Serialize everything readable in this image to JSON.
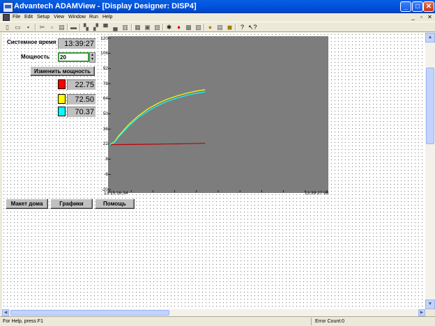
{
  "window": {
    "title": "Advantech ADAMView - [Display Designer: DISP4]",
    "minimize_glyph": "_",
    "maximize_glyph": "□",
    "close_glyph": "✕"
  },
  "menu": {
    "items": [
      "File",
      "Edit",
      "Setup",
      "View",
      "Window",
      "Run",
      "Help"
    ],
    "mdi_controls": [
      "_",
      "▫",
      "✕"
    ]
  },
  "toolbar": {
    "icons": [
      "new-icon",
      "open-icon",
      "save-icon",
      "cut-icon",
      "copy-icon",
      "paste-icon",
      "print-icon",
      "align-left-icon",
      "align-right-icon",
      "align-top-icon",
      "align-bottom-icon",
      "space-h-icon",
      "space-v-icon",
      "size-icon",
      "pointer-icon",
      "run-icon",
      "step-icon",
      "stop-icon",
      "lock-icon",
      "tool1-icon",
      "tool2-icon",
      "help-icon",
      "context-help-icon"
    ]
  },
  "panel": {
    "system_time_label": "Системное время",
    "system_time_value": "13:39:27",
    "power_label": "Мощность",
    "power_value": "20",
    "change_power_button": "Изменить мощность",
    "readings": [
      {
        "color": "#ff0000",
        "value": "22.75"
      },
      {
        "color": "#ffff00",
        "value": "72.50"
      },
      {
        "color": "#00ffff",
        "value": "70.37"
      }
    ],
    "buttons": {
      "house_layout": "Макет дома",
      "charts": "Графики",
      "help": "Помощь"
    }
  },
  "chart_data": {
    "type": "line",
    "background": "#7d7d7d",
    "ylim": [
      -20,
      120
    ],
    "yticks": [
      "120",
      "106",
      "92",
      "78",
      "64",
      "50",
      "36",
      "22",
      "8",
      "-6",
      "-20"
    ],
    "xticks": [
      "13:15:16.34",
      "13:39:27.98"
    ],
    "xrange_fraction_shown": 0.44,
    "series": [
      {
        "color": "#c00000",
        "x": [
          0,
          0.2,
          0.4,
          0.6,
          0.8,
          1.0
        ],
        "y": [
          21.5,
          21.7,
          21.9,
          22.1,
          22.4,
          22.75
        ]
      },
      {
        "color": "#ffff00",
        "x": [
          0,
          0.05,
          0.1,
          0.2,
          0.3,
          0.4,
          0.5,
          0.6,
          0.7,
          0.8,
          0.9,
          1.0
        ],
        "y": [
          21.5,
          24,
          30,
          40,
          48,
          54.5,
          59.5,
          63.5,
          66.5,
          69,
          71,
          72.5
        ]
      },
      {
        "color": "#00ffff",
        "x": [
          0,
          0.05,
          0.1,
          0.2,
          0.3,
          0.4,
          0.5,
          0.6,
          0.7,
          0.8,
          0.9,
          1.0
        ],
        "y": [
          21.5,
          23.5,
          29,
          38.5,
          46.5,
          52.5,
          57.5,
          61.5,
          64.5,
          67,
          69,
          70.37
        ]
      }
    ]
  },
  "status": {
    "help_text": "For Help, press F1",
    "error_count": "Error Count:0"
  }
}
